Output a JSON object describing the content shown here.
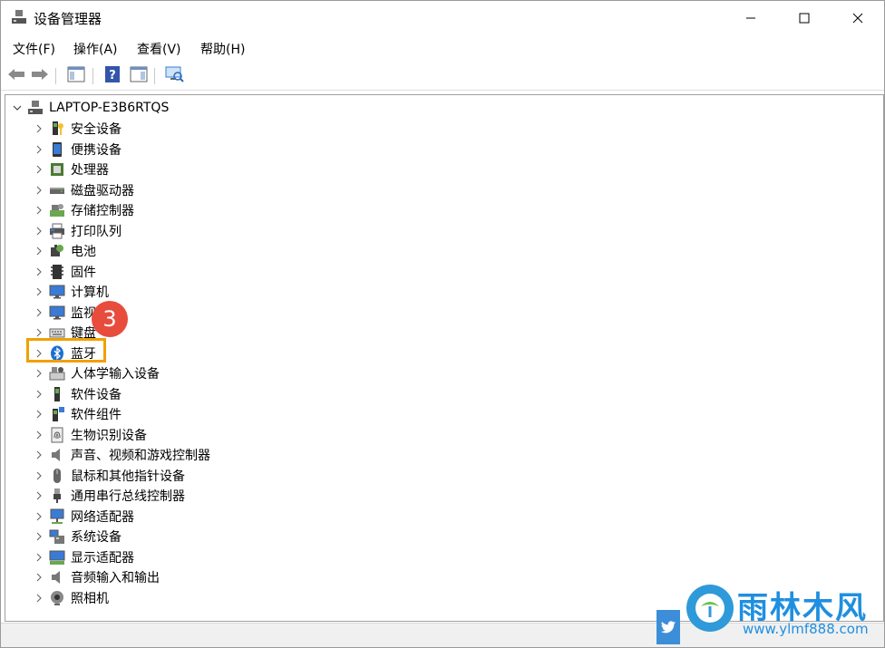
{
  "window": {
    "title": "设备管理器"
  },
  "menu": [
    {
      "id": "file",
      "label": "文件(F)"
    },
    {
      "id": "action",
      "label": "操作(A)"
    },
    {
      "id": "view",
      "label": "查看(V)"
    },
    {
      "id": "help",
      "label": "帮助(H)"
    }
  ],
  "tree": {
    "root": {
      "label": "LAPTOP-E3B6RTQS",
      "icon": "computer-icon"
    },
    "items": [
      {
        "id": "security",
        "label": "安全设备",
        "icon": "security-key-icon"
      },
      {
        "id": "portable",
        "label": "便携设备",
        "icon": "portable-device-icon"
      },
      {
        "id": "processor",
        "label": "处理器",
        "icon": "processor-icon"
      },
      {
        "id": "disk",
        "label": "磁盘驱动器",
        "icon": "disk-drive-icon"
      },
      {
        "id": "storage",
        "label": "存储控制器",
        "icon": "storage-controller-icon"
      },
      {
        "id": "print",
        "label": "打印队列",
        "icon": "printer-icon"
      },
      {
        "id": "battery",
        "label": "电池",
        "icon": "battery-icon"
      },
      {
        "id": "firmware",
        "label": "固件",
        "icon": "firmware-icon"
      },
      {
        "id": "computer",
        "label": "计算机",
        "icon": "monitor-icon"
      },
      {
        "id": "monitor",
        "label": "监视器",
        "icon": "monitor-icon"
      },
      {
        "id": "keyboard",
        "label": "键盘",
        "icon": "keyboard-icon"
      },
      {
        "id": "bluetooth",
        "label": "蓝牙",
        "icon": "bluetooth-icon"
      },
      {
        "id": "hid",
        "label": "人体学输入设备",
        "icon": "hid-icon"
      },
      {
        "id": "software-device",
        "label": "软件设备",
        "icon": "software-device-icon"
      },
      {
        "id": "software-component",
        "label": "软件组件",
        "icon": "software-component-icon"
      },
      {
        "id": "biometric",
        "label": "生物识别设备",
        "icon": "fingerprint-icon"
      },
      {
        "id": "audio",
        "label": "声音、视频和游戏控制器",
        "icon": "speaker-icon"
      },
      {
        "id": "mouse",
        "label": "鼠标和其他指针设备",
        "icon": "mouse-icon"
      },
      {
        "id": "usb",
        "label": "通用串行总线控制器",
        "icon": "usb-icon"
      },
      {
        "id": "network",
        "label": "网络适配器",
        "icon": "network-adapter-icon"
      },
      {
        "id": "system",
        "label": "系统设备",
        "icon": "system-device-icon"
      },
      {
        "id": "display",
        "label": "显示适配器",
        "icon": "display-adapter-icon"
      },
      {
        "id": "audio-io",
        "label": "音频输入和输出",
        "icon": "speaker-icon"
      },
      {
        "id": "camera",
        "label": "照相机",
        "icon": "camera-icon"
      }
    ]
  },
  "annotation": {
    "step": "3",
    "highlight_item": "bluetooth",
    "color": "#f0a000",
    "badge_color": "#e84c3d"
  },
  "watermark": {
    "title": "雨林木风",
    "url": "www.ylmf888.com"
  }
}
